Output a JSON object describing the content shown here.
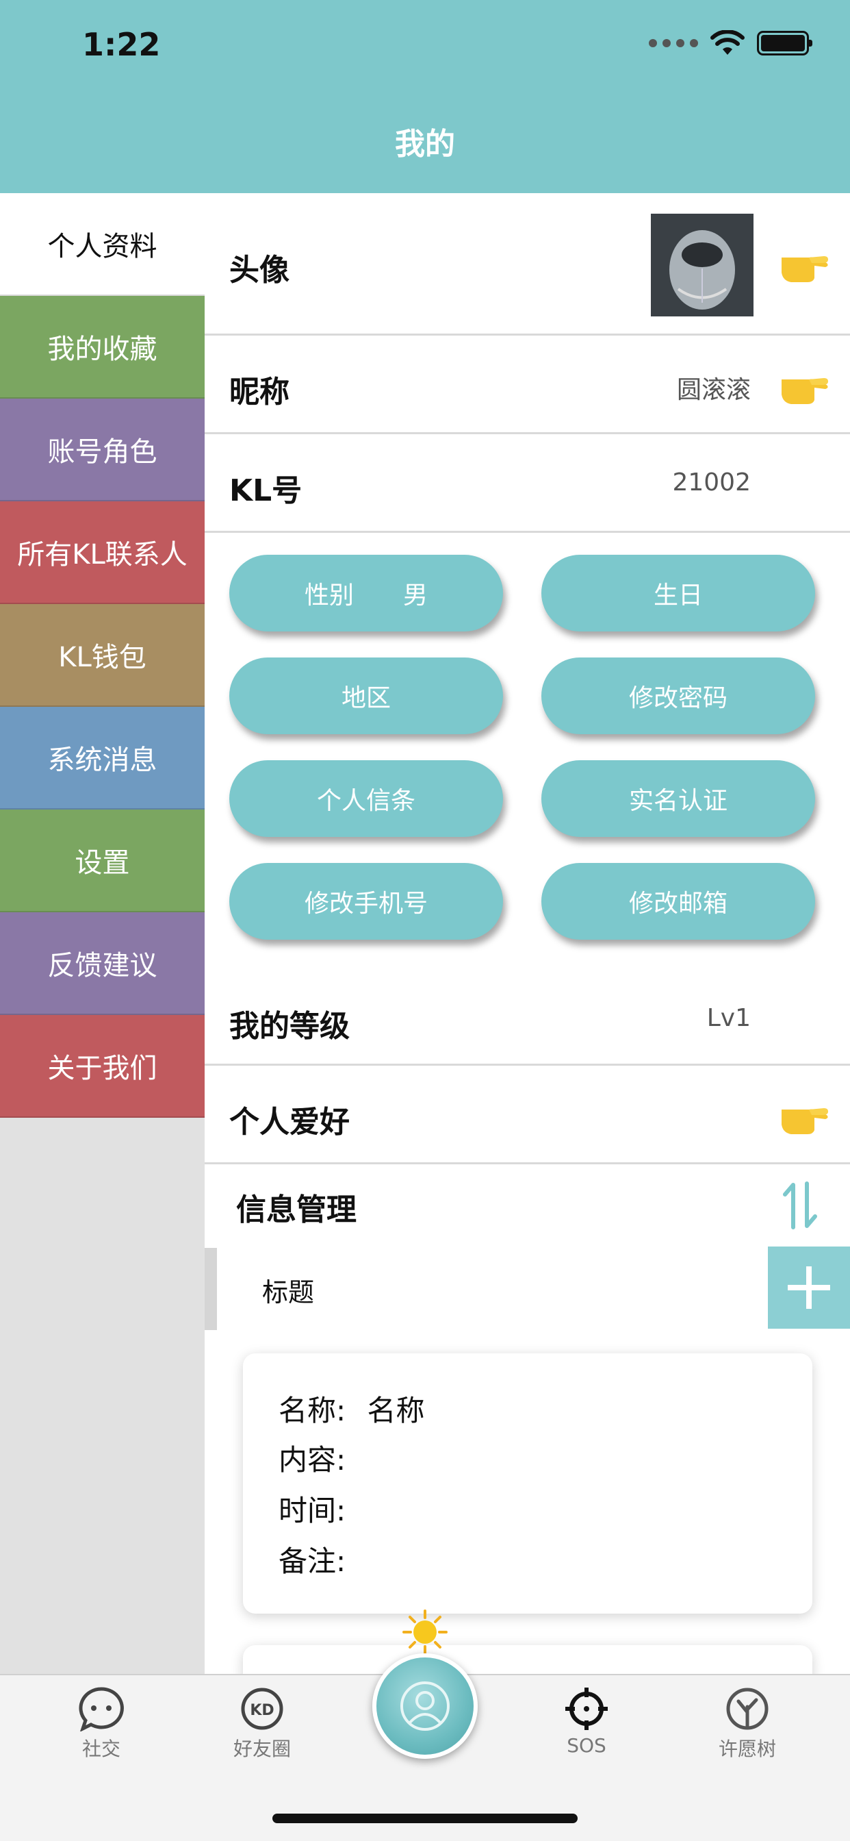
{
  "status_bar": {
    "time": "1:22"
  },
  "header": {
    "title": "我的"
  },
  "sidebar": {
    "items": [
      {
        "label": "个人资料",
        "color": "#ffffff"
      },
      {
        "label": "我的收藏",
        "color": "#7ba661"
      },
      {
        "label": "账号角色",
        "color": "#8a78a6"
      },
      {
        "label": "所有KL联系人",
        "color": "#c05a5e"
      },
      {
        "label": "KL钱包",
        "color": "#a88e62"
      },
      {
        "label": "系统消息",
        "color": "#6f9ac1"
      },
      {
        "label": "设置",
        "color": "#7ba661"
      },
      {
        "label": "反馈建议",
        "color": "#8a78a6"
      },
      {
        "label": "关于我们",
        "color": "#c05a5e"
      }
    ]
  },
  "profile": {
    "avatar_label": "头像",
    "nickname_label": "昵称",
    "nickname_value": "圆滚滚",
    "kl_label": "KL号",
    "kl_value": "21002",
    "level_label": "我的等级",
    "level_value": "Lv1",
    "hobby_label": "个人爱好"
  },
  "buttons": {
    "gender": "性别　　男",
    "birthday": "生日",
    "region": "地区",
    "change_password": "修改密码",
    "credo": "个人信条",
    "real_name": "实名认证",
    "change_phone": "修改手机号",
    "change_email": "修改邮箱"
  },
  "info": {
    "section_title": "信息管理",
    "sub_title": "标题",
    "card": {
      "name_label": "名称:",
      "name_value": "名称",
      "content_label": "内容:",
      "time_label": "时间:",
      "note_label": "备注:"
    }
  },
  "tabbar": {
    "social": "社交",
    "friends": "好友圈",
    "sos": "SOS",
    "wish_tree": "许愿树"
  },
  "colors": {
    "accent": "#7ec8cb",
    "pill": "#7cc8cc"
  },
  "icons": [
    "pointing-hand-icon",
    "sort-icon",
    "plus-icon",
    "chat-icon",
    "friends-circle-icon",
    "profile-icon",
    "crosshair-icon",
    "tree-icon",
    "sun-icon"
  ]
}
